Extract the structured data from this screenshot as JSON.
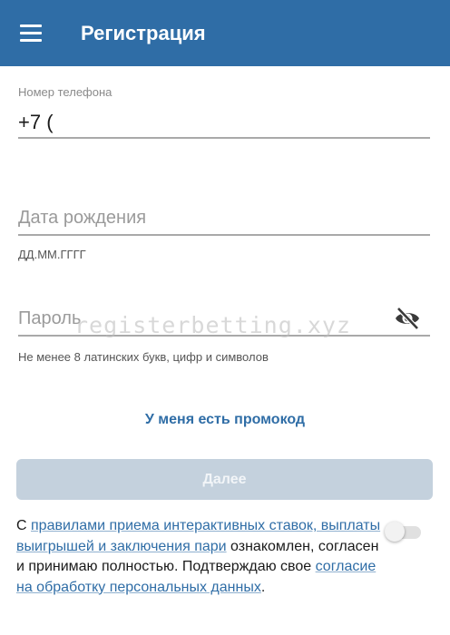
{
  "appbar": {
    "title": "Регистрация",
    "menu_icon": "hamburger-menu-icon",
    "background": "#2f6da6"
  },
  "phone": {
    "label": "Номер телефона",
    "value": "+7 ("
  },
  "birth_date": {
    "placeholder": "Дата рождения",
    "hint": "ДД.ММ.ГГГГ"
  },
  "password": {
    "placeholder": "Пароль",
    "visibility_icon": "eye-off-icon",
    "hint": "Не менее 8 латинских букв, цифр и символов"
  },
  "watermark": "registerbetting.xyz",
  "promo": {
    "label": "У меня есть промокод"
  },
  "next_button": {
    "label": "Далее",
    "enabled": false
  },
  "consent": {
    "prefix": "С ",
    "rules_link": "правилами приема интерактивных ставок, выплаты выигрышей и заключения пари",
    "middle": " ознакомлен, согласен и принимаю полностью. Подтверждаю свое ",
    "personal_data_link": "согласие на обработку персональных данных",
    "suffix": ".",
    "toggle_on": false
  },
  "colors": {
    "accent": "#2f6da6",
    "disabled_button": "#c4d1dd"
  }
}
